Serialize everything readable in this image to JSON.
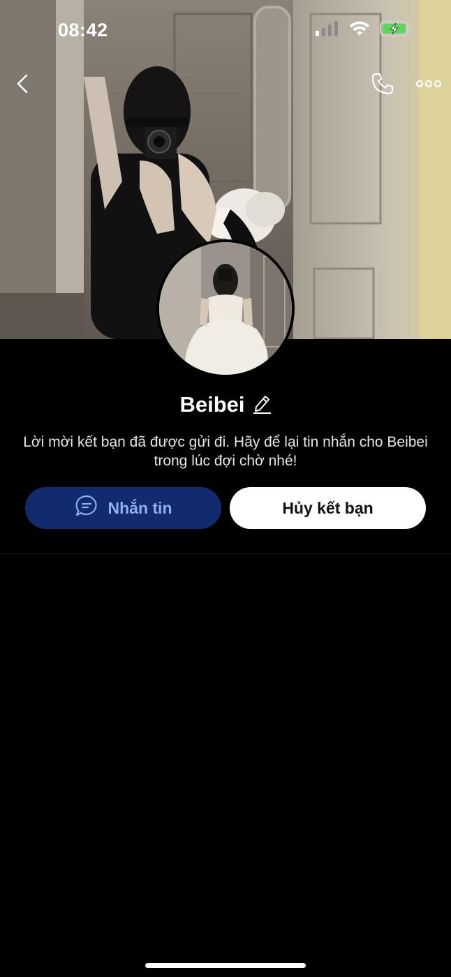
{
  "status_bar": {
    "time": "08:42"
  },
  "icons": {
    "back": "chevron-left-icon",
    "call": "phone-icon",
    "more": "more-horizontal-icon",
    "edit": "pencil-icon",
    "message": "chat-bubble-icon",
    "signal": "cellular-signal-icon",
    "wifi": "wifi-icon",
    "battery": "battery-charging-icon"
  },
  "profile": {
    "name": "Beibei",
    "notice": "Lời mời kết bạn đã được gửi đi. Hãy để lại tin nhắn cho Beibei trong lúc đợi chờ nhé!"
  },
  "actions": {
    "message_label": "Nhắn tin",
    "unfriend_label": "Hủy kết bạn"
  },
  "colors": {
    "background": "#000000",
    "message_button_bg": "#122a6e",
    "message_button_text": "#8fb0f0",
    "unfriend_button_bg": "#ffffff",
    "battery_fill": "#5cd65c"
  }
}
